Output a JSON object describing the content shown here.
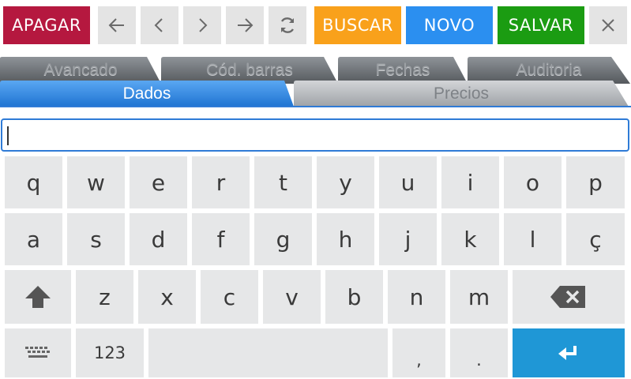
{
  "toolbar": {
    "delete_label": "APAGAR",
    "search_label": "BUSCAR",
    "new_label": "NOVO",
    "save_label": "SALVAR",
    "colors": {
      "delete": "#b5183f",
      "search": "#f9a11b",
      "new": "#2b8ff0",
      "save": "#1b9c12"
    }
  },
  "tabs": {
    "back_row": [
      "Avancado",
      "Cód. barras",
      "Fechas",
      "Auditoria"
    ],
    "front_row": [
      "Dados",
      "Precios"
    ],
    "active": "Dados"
  },
  "input": {
    "value": ""
  },
  "keyboard": {
    "row1": [
      "q",
      "w",
      "e",
      "r",
      "t",
      "y",
      "u",
      "i",
      "o",
      "p"
    ],
    "row2": [
      "a",
      "s",
      "d",
      "f",
      "g",
      "h",
      "j",
      "k",
      "l",
      "ç"
    ],
    "row3": [
      "z",
      "x",
      "c",
      "v",
      "b",
      "n",
      "m"
    ],
    "numbers_label": "123",
    "comma": ",",
    "period": ".",
    "icons": {
      "shift": "shift-icon",
      "backspace": "backspace-icon",
      "enter": "enter-icon",
      "keyboard": "keyboard-icon"
    }
  }
}
